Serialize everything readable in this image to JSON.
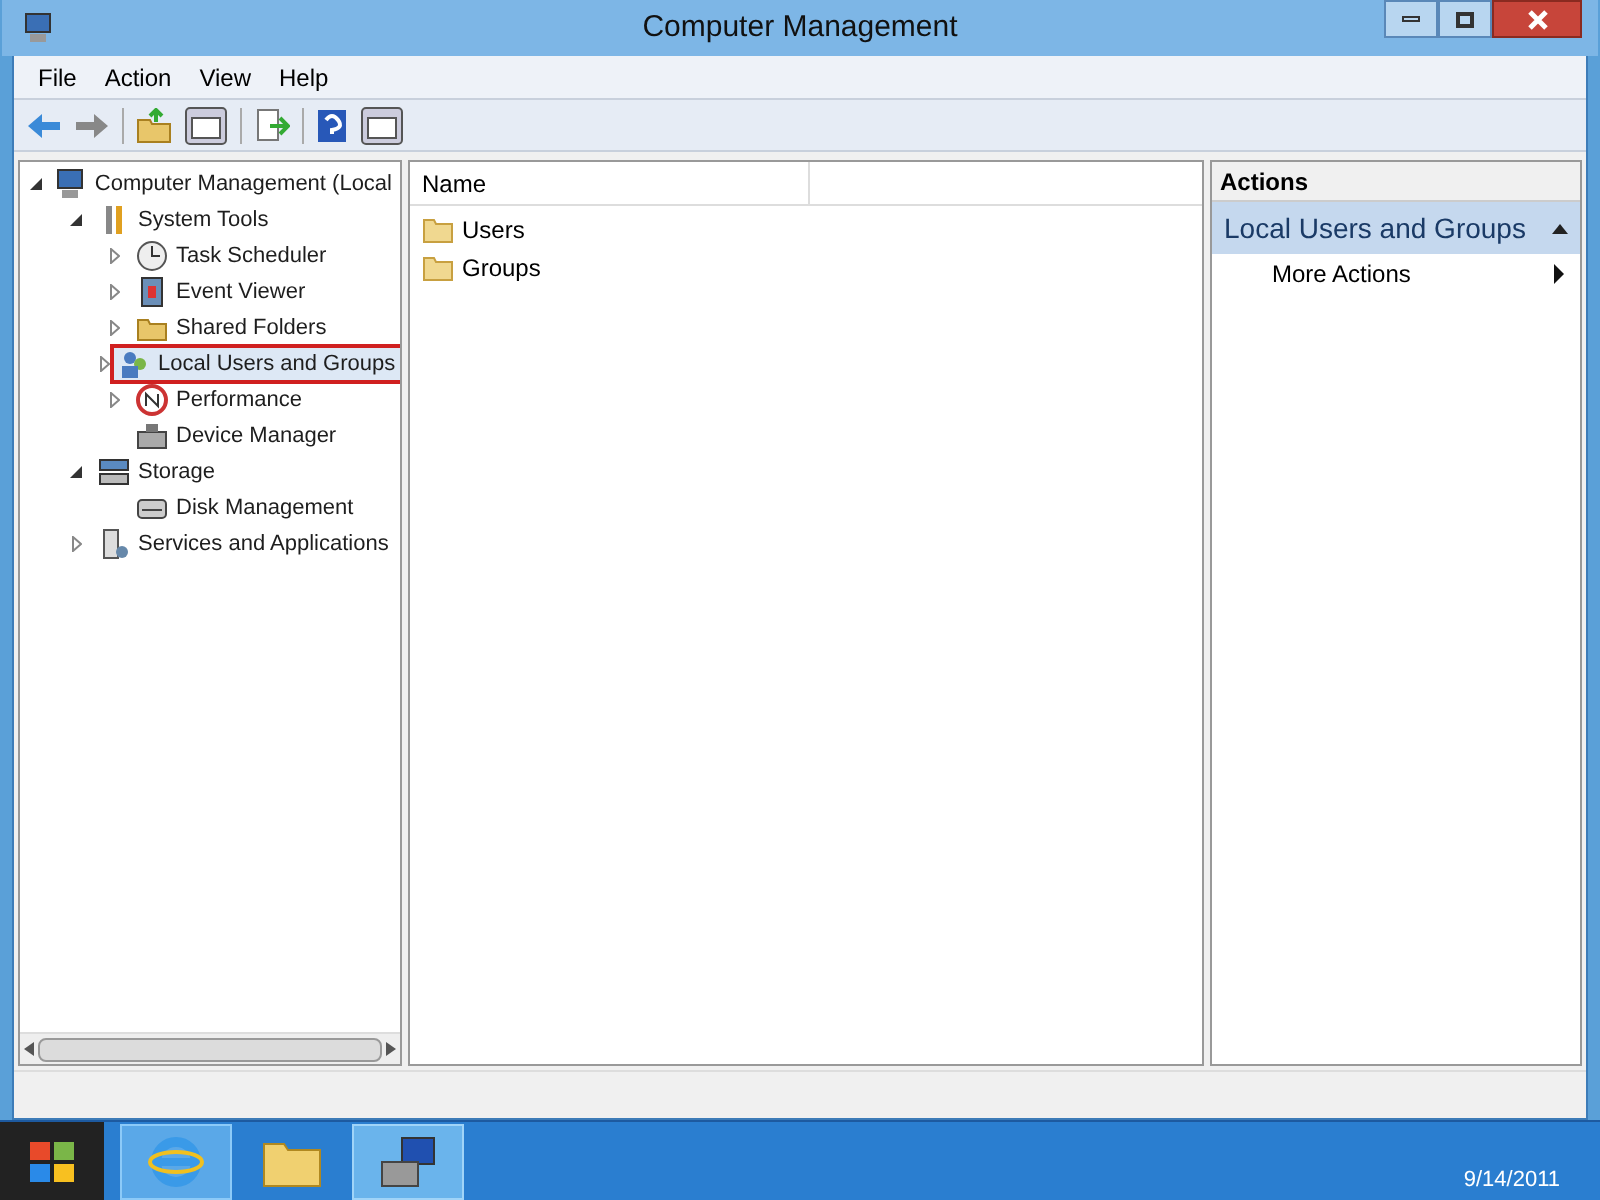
{
  "window": {
    "title": "Computer Management"
  },
  "menu": [
    "File",
    "Action",
    "View",
    "Help"
  ],
  "tree": [
    {
      "label": "Computer Management (Local",
      "expanded": true,
      "children": [
        {
          "label": "System Tools",
          "expanded": true,
          "children": [
            {
              "label": "Task Scheduler",
              "expanded": false,
              "highlighted": false
            },
            {
              "label": "Event Viewer",
              "expanded": false,
              "highlighted": false
            },
            {
              "label": "Shared Folders",
              "expanded": false,
              "highlighted": false
            },
            {
              "label": "Local Users and Groups",
              "expanded": false,
              "highlighted": true
            },
            {
              "label": "Performance",
              "expanded": false,
              "highlighted": false
            },
            {
              "label": "Device Manager",
              "highlighted": false
            }
          ]
        },
        {
          "label": "Storage",
          "expanded": true,
          "children": [
            {
              "label": "Disk Management",
              "highlighted": false
            }
          ]
        },
        {
          "label": "Services and Applications",
          "expanded": false
        }
      ]
    }
  ],
  "list": {
    "columns": [
      "Name"
    ],
    "rows": [
      "Users",
      "Groups"
    ]
  },
  "actions": {
    "title": "Actions",
    "section": "Local Users and Groups",
    "items": [
      "More Actions"
    ]
  },
  "taskbar": {
    "date": "9/14/2011"
  }
}
